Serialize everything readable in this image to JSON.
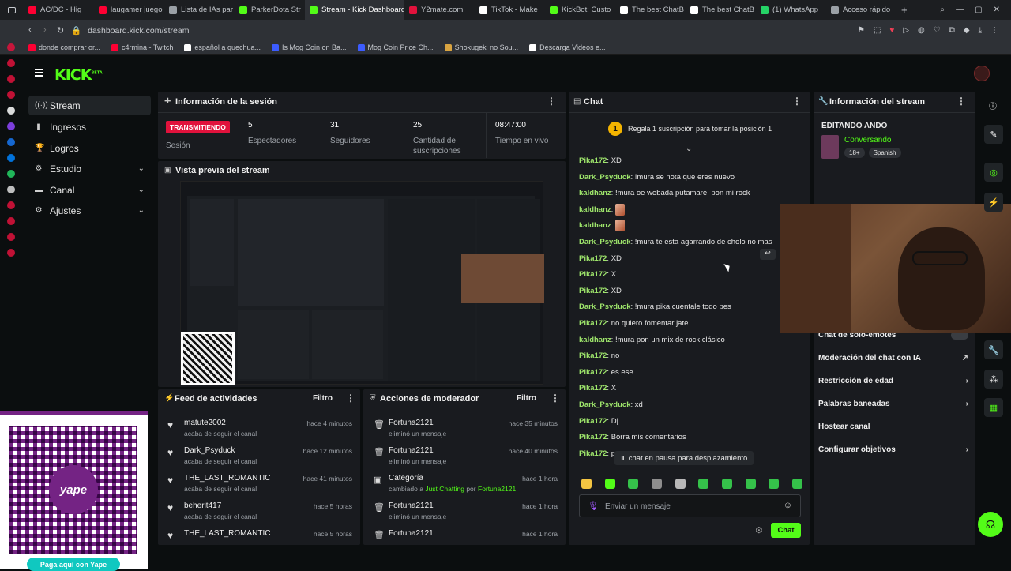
{
  "browser": {
    "tabs": [
      {
        "label": "AC/DC - Hig",
        "color": "#ff0033"
      },
      {
        "label": "laugamer juego",
        "color": "#ff0033"
      },
      {
        "label": "Lista de IAs par",
        "color": "#9aa0a6"
      },
      {
        "label": "ParkerDota Str",
        "color": "#53fc18"
      },
      {
        "label": "Stream - Kick Dashboard",
        "color": "#53fc18",
        "active": true
      },
      {
        "label": "Y2mate.com",
        "color": "#e1123c"
      },
      {
        "label": "TikTok - Make",
        "color": "#ffffff"
      },
      {
        "label": "KickBot: Custo",
        "color": "#53fc18"
      },
      {
        "label": "The best ChatB",
        "color": "#ffffff"
      },
      {
        "label": "The best ChatB",
        "color": "#ffffff"
      },
      {
        "label": "(1) WhatsApp",
        "color": "#25d366"
      },
      {
        "label": "Acceso rápido",
        "color": "#9aa0a6"
      }
    ],
    "url": "dashboard.kick.com/stream",
    "bookmarks": [
      {
        "label": "donde comprar or...",
        "color": "#ff0033"
      },
      {
        "label": "c4rmina - Twitch",
        "color": "#ff0033"
      },
      {
        "label": "español a quechua...",
        "color": "#ffffff"
      },
      {
        "label": "Is Mog Coin on Ba...",
        "color": "#3c5cff"
      },
      {
        "label": "Mog Coin Price Ch...",
        "color": "#3c5cff"
      },
      {
        "label": "Shokugeki no Sou...",
        "color": "#d9a441"
      },
      {
        "label": "Descarga Videos e...",
        "color": "#ffffff"
      }
    ]
  },
  "header": {
    "logo": "KICK",
    "logo_beta": "BETA"
  },
  "sidebar": {
    "items": [
      {
        "label": "Stream",
        "icon": "broadcast-icon",
        "glyph": "((·))",
        "active": true
      },
      {
        "label": "Ingresos",
        "icon": "chart-icon",
        "glyph": "▮"
      },
      {
        "label": "Logros",
        "icon": "trophy-icon",
        "glyph": "🏆"
      },
      {
        "label": "Estudio",
        "icon": "sliders-icon",
        "glyph": "⚙",
        "expand": true
      },
      {
        "label": "Canal",
        "icon": "channel-icon",
        "glyph": "▬",
        "expand": true
      },
      {
        "label": "Ajustes",
        "icon": "gear-icon",
        "glyph": "⚙",
        "expand": true
      }
    ]
  },
  "session": {
    "title": "Información de la sesión",
    "live_badge": "TRANSMITIENDO",
    "session_label": "Sesión",
    "stats": [
      {
        "value": "5",
        "label": "Espectadores"
      },
      {
        "value": "31",
        "label": "Seguidores"
      },
      {
        "value": "25",
        "label": "Cantidad de suscripciones"
      },
      {
        "value": "08:47:00",
        "label": "Tiempo en vivo"
      }
    ]
  },
  "preview": {
    "title": "Vista previa del stream"
  },
  "activity": {
    "title": "Feed de actividades",
    "filter": "Filtro",
    "rows": [
      {
        "name": "matute2002",
        "sub": "acaba de seguir el canal",
        "time": "hace 4 minutos"
      },
      {
        "name": "Dark_Psyduck",
        "sub": "acaba de seguir el canal",
        "time": "hace 12 minutos"
      },
      {
        "name": "THE_LAST_ROMANTIC",
        "sub": "acaba de seguir el canal",
        "time": "hace 41 minutos"
      },
      {
        "name": "beherit417",
        "sub": "acaba de seguir el canal",
        "time": "hace 5 horas"
      },
      {
        "name": "THE_LAST_ROMANTIC",
        "sub": "",
        "time": "hace 5 horas"
      }
    ]
  },
  "moderator": {
    "title": "Acciones de moderador",
    "filter": "Filtro",
    "rows": [
      {
        "name": "Fortuna2121",
        "sub": "eliminó un mensaje",
        "time": "hace 35 minutos"
      },
      {
        "name": "Fortuna2121",
        "sub": "eliminó un mensaje",
        "time": "hace 40 minutos"
      },
      {
        "name": "Categoría",
        "sub_prefix": "cambiado a",
        "sub_highlight": "Just Chatting",
        "sub_mid": "por",
        "sub_user": "Fortuna2121",
        "time": "hace 1 hora"
      },
      {
        "name": "Fortuna2121",
        "sub": "eliminó un mensaje",
        "time": "hace 1 hora"
      },
      {
        "name": "Fortuna2121",
        "sub": "",
        "time": "hace 1 hora"
      }
    ]
  },
  "chat": {
    "title": "Chat",
    "gift_rank": "1",
    "gift_text": "Regala 1 suscripción para tomar la posición 1",
    "messages": [
      {
        "user": "Pika172",
        "text": "XD"
      },
      {
        "user": "Dark_Psyduck",
        "text": "!mura se nota que eres nuevo"
      },
      {
        "user": "kaldhanz",
        "text": "!mura oe webada putamare, pon mi rock"
      },
      {
        "user": "kaldhanz",
        "text": ""
      },
      {
        "user": "kaldhanz",
        "text": ""
      },
      {
        "user": "Dark_Psyduck",
        "text": "!mura te esta agarrando de cholo no mas"
      },
      {
        "user": "Pika172",
        "text": "XD"
      },
      {
        "user": "Pika172",
        "text": "X"
      },
      {
        "user": "Pika172",
        "text": "XD"
      },
      {
        "user": "Dark_Psyduck",
        "text": "!mura pika cuentale todo pes"
      },
      {
        "user": "Pika172",
        "text": "no quiero fomentar jate"
      },
      {
        "user": "kaldhanz",
        "text": "!mura pon un mix de rock clásico"
      },
      {
        "user": "Pika172",
        "text": "no"
      },
      {
        "user": "Pika172",
        "text": "es ese"
      },
      {
        "user": "Pika172",
        "text": "X"
      },
      {
        "user": "Dark_Psyduck",
        "text": "xd"
      },
      {
        "user": "Pika172",
        "text": "D|"
      },
      {
        "user": "Pika172",
        "text": "Borra mis comentarios"
      },
      {
        "user": "Pika172",
        "text": "p"
      }
    ],
    "paused_text": "chat en pausa para desplazamiento",
    "input_placeholder": "Enviar un mensaje",
    "send_label": "Chat",
    "emote_colors": [
      "#f4c542",
      "#53fc18",
      "#35c24a",
      "#8e8e8e",
      "#b8b8b8",
      "#35c24a",
      "#35c24a",
      "#35c24a",
      "#35c24a",
      "#35c24a"
    ]
  },
  "stream_info": {
    "title": "Información del stream",
    "stream_title": "EDITANDO ANDO",
    "category": "Conversando",
    "tags": [
      "18+",
      "Spanish"
    ],
    "settings": [
      {
        "label": "Chat de solo-emotes",
        "right": "toggle"
      },
      {
        "label": "Moderación del chat con IA",
        "right": "↗"
      },
      {
        "label": "Restricción de edad",
        "right": "›"
      },
      {
        "label": "Palabras baneadas",
        "right": "›"
      },
      {
        "label": "Hostear canal",
        "right": ""
      },
      {
        "label": "Configurar objetivos",
        "right": "›"
      }
    ]
  },
  "overlay": {
    "yape_button": "Paga aquí con Yape",
    "yape_logo": "yape"
  },
  "colors": {
    "accent": "#53fc18",
    "live": "#e1123c",
    "panel": "#191b1f"
  }
}
